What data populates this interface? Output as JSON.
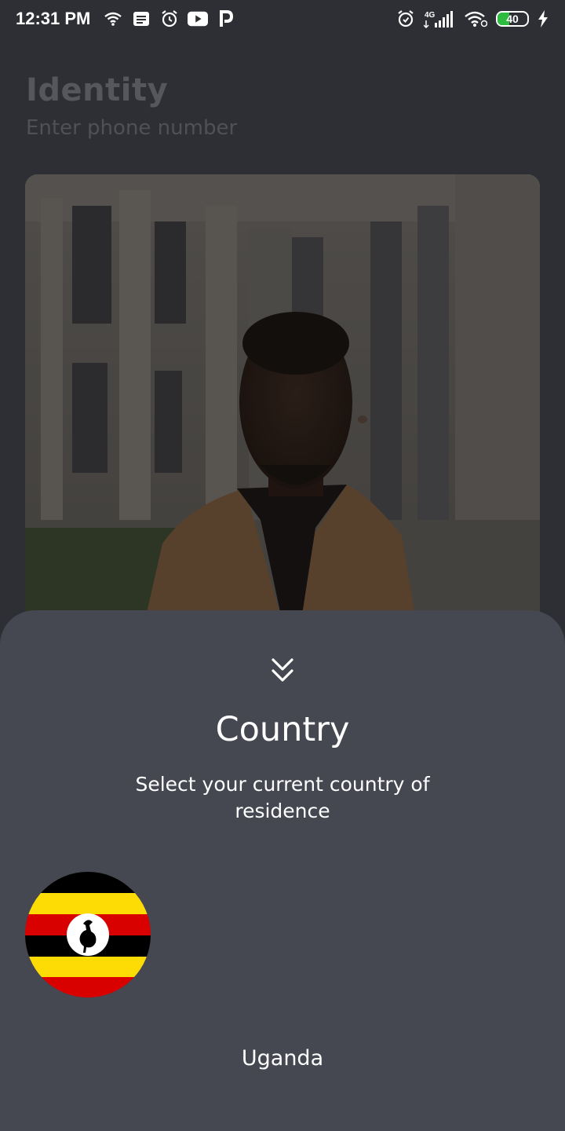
{
  "status_bar": {
    "time": "12:31 PM",
    "network_label": "4G",
    "battery_level": "40",
    "battery_fraction": 0.4,
    "icons": [
      "wifi-icon",
      "message-icon",
      "alarm-icon",
      "youtube-icon",
      "paytm-icon",
      "alarm-icon",
      "signal-icon",
      "wifi-icon",
      "battery-icon",
      "charging-icon"
    ]
  },
  "page": {
    "title": "Identity",
    "subtitle": "Enter phone number"
  },
  "sheet": {
    "title": "Country",
    "subtitle": "Select your current country of residence",
    "country": "Uganda",
    "collapse_icon": "chevron-double-down-icon",
    "flag_icon": "uganda-flag-icon"
  },
  "colors": {
    "background": "#2d2f35",
    "sheet": "#454751",
    "text": "#ffffff",
    "flag_black": "#000000",
    "flag_yellow": "#fcdc04",
    "flag_red": "#d90000"
  }
}
